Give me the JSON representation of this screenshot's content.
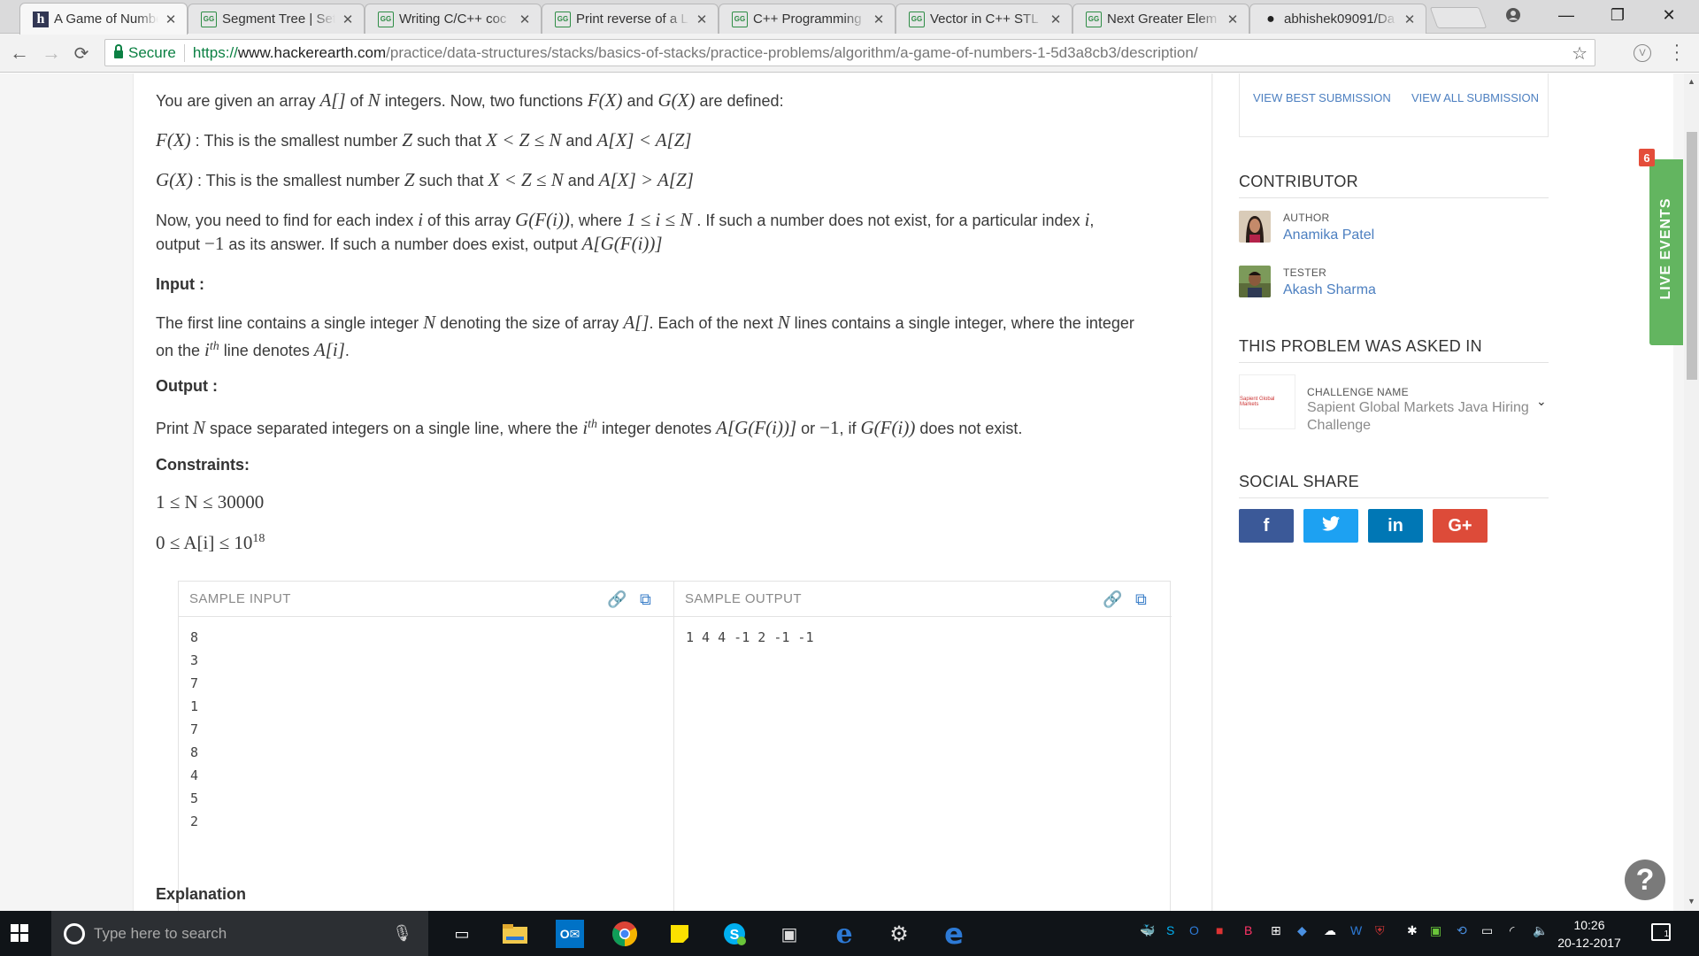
{
  "browser": {
    "tabs": [
      {
        "title": "A Game of Numbe",
        "favicon": "hackerearth-icon",
        "active": true
      },
      {
        "title": "Segment Tree | Set",
        "favicon": "gfg-icon"
      },
      {
        "title": "Writing C/C++ coc",
        "favicon": "gfg-icon"
      },
      {
        "title": "Print reverse of a L",
        "favicon": "gfg-icon"
      },
      {
        "title": "C++ Programming",
        "favicon": "gfg-icon"
      },
      {
        "title": "Vector in C++ STL",
        "favicon": "gfg-icon"
      },
      {
        "title": "Next Greater Elem",
        "favicon": "gfg-icon"
      },
      {
        "title": "abhishek09091/Da",
        "favicon": "github-icon"
      }
    ],
    "tab_close": "✕",
    "gfg_label": "GG",
    "hackerearth_label": "h",
    "window_controls": {
      "minimize": "—",
      "maximize": "❐",
      "close": "✕"
    },
    "address": {
      "secure_label": "Secure",
      "url_scheme": "https://",
      "url_host": "www.hackerearth.com",
      "url_path": "/practice/data-structures/stacks/basics-of-stacks/practice-problems/algorithm/a-game-of-numbers-1-5d3a8cb3/description/"
    }
  },
  "problem": {
    "intro": [
      "You are given an array ",
      "A[]",
      " of ",
      "N",
      " integers. Now, two functions ",
      "F(X)",
      " and ",
      "G(X)",
      " are defined:"
    ],
    "f_def": [
      "F(X)",
      " : This is the smallest number ",
      "Z",
      " such that ",
      "X < Z ≤ N",
      " and ",
      "A[X] < A[Z]"
    ],
    "g_def": [
      "G(X)",
      " : This is the smallest number ",
      "Z",
      " such that ",
      "X < Z ≤ N",
      " and ",
      "A[X] > A[Z]"
    ],
    "task_l1": [
      "Now, you need to find for each index ",
      "i",
      " of this array ",
      "G(F(i))",
      ", where ",
      "1 ≤ i ≤ N",
      " . If such a number does not exist, for a particular index ",
      "i",
      ","
    ],
    "task_l2": [
      "output ",
      "−1",
      " as its answer. If such a number does exist, output ",
      "A[G(F(i))]"
    ],
    "input_heading": "Input :",
    "input_l1": [
      "The first line contains a single integer ",
      "N",
      " denoting the size of array ",
      "A[]",
      ". Each of the next ",
      "N",
      " lines contains a single integer, where the integer"
    ],
    "input_l2": [
      "on the ",
      "i",
      "th",
      " line denotes ",
      "A[i]",
      "."
    ],
    "output_heading": "Output :",
    "output_l1": [
      "Print ",
      "N",
      " space separated integers on a single line, where the ",
      "i",
      "th",
      " integer denotes ",
      "A[G(F(i))]",
      " or ",
      "−1",
      ", if ",
      "G(F(i))",
      " does not exist."
    ],
    "constraints_heading": "Constraints:",
    "c1": "1 ≤ N ≤ 30000",
    "c2_base": "0 ≤ A[i] ≤ 10",
    "c2_exp": "18",
    "sample_input_label": "SAMPLE INPUT",
    "sample_output_label": "SAMPLE OUTPUT",
    "sample_input": [
      "8",
      "3",
      "7",
      "1",
      "7",
      "8",
      "4",
      "5",
      "2"
    ],
    "sample_output": "1 4 4 -1 2 -1 -1",
    "explanation_heading": "Explanation"
  },
  "sidebar": {
    "view_best": "VIEW BEST SUBMISSION",
    "view_all": "VIEW ALL SUBMISSION",
    "contributor_heading": "CONTRIBUTOR",
    "author_role": "AUTHOR",
    "author_name": "Anamika Patel",
    "tester_role": "TESTER",
    "tester_name": "Akash Sharma",
    "asked_heading": "THIS PROBLEM WAS ASKED IN",
    "challenge_label": "CHALLENGE NAME",
    "challenge_name_l1": "Sapient Global Markets Java Hiring",
    "challenge_name_l2": "Challenge",
    "company_logo_text": "Sapient Global Markets",
    "social_heading": "SOCIAL SHARE",
    "social": {
      "facebook": "f",
      "twitter": "🐦",
      "linkedin": "in",
      "gplus": "G+"
    },
    "live_events": "LIVE EVENTS",
    "live_count": "6",
    "help": "?"
  },
  "taskbar": {
    "search_placeholder": "Type here to search",
    "time": "10:26",
    "date": "20-12-2017",
    "notifications": "1"
  },
  "colors": {
    "link_blue": "#4c7fc0",
    "facebook": "#3b5998",
    "twitter": "#1da1f2",
    "linkedin": "#0077b5",
    "gplus": "#dd4b39",
    "live_green": "#63b560"
  }
}
